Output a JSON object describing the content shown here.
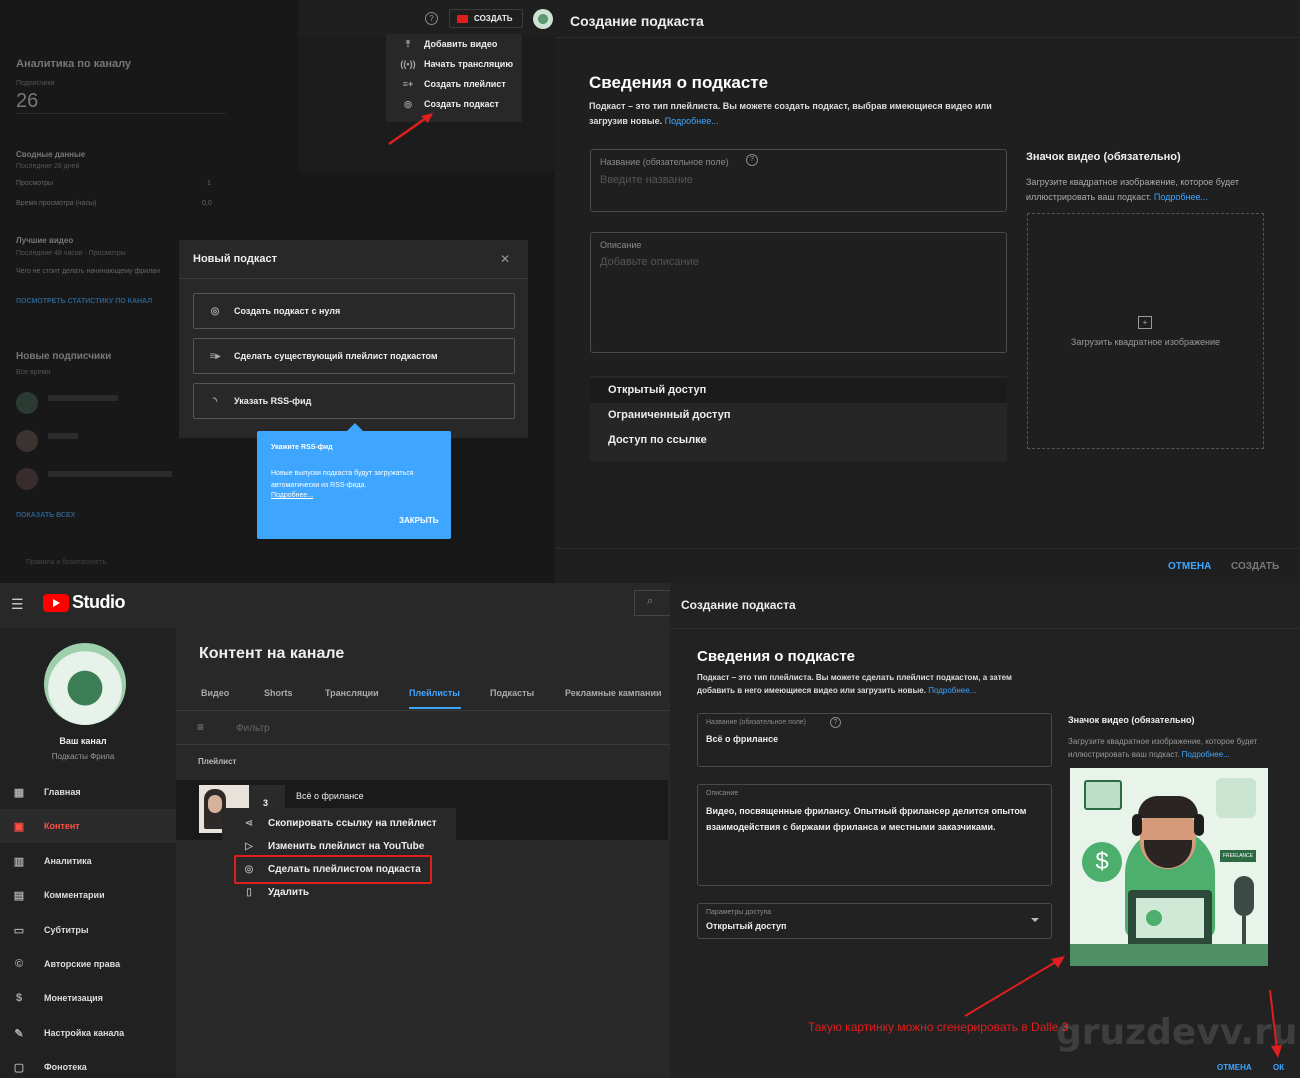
{
  "top_left": {
    "analytics_title": "Аналитика по каналу",
    "subscribers_label": "Подписчики",
    "subscribers_count": "26",
    "summary_title": "Сводные данные",
    "summary_period": "Последние 28 дней",
    "views_label": "Просмотры",
    "views_value": "1",
    "watch_label": "Время просмотра (часы)",
    "watch_value": "0,0",
    "best_video_title": "Лучшие видео",
    "best_video_sub": "Последние 48 часов · Просмотры",
    "best_video_item": "Чего не стоит делать начинающему фрилан",
    "view_stats": "ПОСМОТРЕТЬ СТАТИСТИКУ ПО КАНАЛ",
    "new_subs_title": "Новые подписчики",
    "new_subs_sub": "Все время",
    "show_all": "ПОКАЗАТЬ ВСЕХ",
    "policy": "Правила и безопасность",
    "help_icon": "?",
    "create_label": "СОЗДАТЬ",
    "create_menu": [
      "Добавить видео",
      "Начать трансляцию",
      "Создать плейлист",
      "Создать подкаст"
    ],
    "create_menu_icons": [
      "upload-icon",
      "live-icon",
      "playlist-add-icon",
      "podcast-icon"
    ]
  },
  "modal": {
    "title": "Новый подкаст",
    "close": "✕",
    "options": [
      "Создать подкаст с нуля",
      "Сделать существующий плейлист подкастом",
      "Указать RSS-фид"
    ],
    "tooltip_title": "Укажите RSS-фид",
    "tooltip_text": "Новые выпуски подкаста будут загружаться автоматически из RSS-фида.",
    "tooltip_link": "Подробнее...",
    "tooltip_close": "ЗАКРЫТЬ"
  },
  "top_right": {
    "header_title": "Создание подкаста",
    "section_title": "Сведения о подкасте",
    "section_desc": "Подкаст – это тип плейлиста. Вы можете создать подкаст, выбрав имеющиеся видео или загрузив новые.",
    "more_link": "Подробнее...",
    "name_label": "Название (обязательное поле)",
    "name_placeholder": "Введите название",
    "desc_label": "Описание",
    "desc_placeholder": "Добавьте описание",
    "access_options": [
      "Открытый доступ",
      "Ограниченный доступ",
      "Доступ по ссылке"
    ],
    "thumb_title": "Значок видео (обязательно)",
    "thumb_desc": "Загрузите квадратное изображение, которое будет иллюстрировать ваш подкаст.",
    "thumb_more": "Подробнее...",
    "upload_label": "Загрузить квадратное изображение",
    "cancel": "ОТМЕНА",
    "create": "СОЗДАТЬ"
  },
  "bottom_left": {
    "logo": "Studio",
    "channel_name": "Ваш канал",
    "channel_sub": "Подкасты Фрила",
    "nav": [
      "Главная",
      "Контент",
      "Аналитика",
      "Комментарии",
      "Субтитры",
      "Авторские права",
      "Монетизация",
      "Настройка канала",
      "Фонотека"
    ],
    "nav_icons": [
      "dashboard-icon",
      "content-icon",
      "analytics-icon",
      "comments-icon",
      "subtitles-icon",
      "copyright-icon",
      "monetization-icon",
      "customization-icon",
      "audio-library-icon"
    ],
    "content_title": "Контент на канале",
    "tabs": [
      "Видео",
      "Shorts",
      "Трансляции",
      "Плейлисты",
      "Подкасты",
      "Рекламные кампании"
    ],
    "active_tab": "Плейлисты",
    "filter": "Фильтр",
    "col_playlist": "Плейлист",
    "playlist_name": "Всё о фрилансе",
    "playlist_count": "3",
    "context_menu": [
      "Скопировать ссылку на плейлист",
      "Изменить плейлист на YouTube",
      "Сделать плейлистом подкаста",
      "Удалить"
    ],
    "context_icons": [
      "share-icon",
      "youtube-icon",
      "podcast-icon",
      "trash-icon"
    ]
  },
  "bottom_right": {
    "header_title": "Создание подкаста",
    "section_title": "Сведения о подкасте",
    "section_desc": "Подкаст – это тип плейлиста. Вы можете сделать плейлист подкастом, а затем добавить в него имеющиеся видео или загрузить новые.",
    "more_link": "Подробнее...",
    "name_label": "Название (обязательное поле)",
    "name_value": "Всё о фрилансе",
    "desc_label": "Описание",
    "desc_value": "Видео, посвященные фрилансу. Опытный фрилансер делится опытом взаимодействия с биржами фриланса и местными заказчиками.",
    "access_label": "Параметры доступа",
    "access_value": "Открытый доступ",
    "thumb_title": "Значок видео (обязательно)",
    "thumb_desc": "Загрузите квадратное изображение, которое будет иллюстрировать ваш подкаст.",
    "thumb_more": "Подробнее...",
    "annotation": "Такую картинку можно сгенерировать в Dalle 3",
    "watermark": "gruzdevv.ru",
    "cancel": "ОТМЕНА",
    "ok": "ОК",
    "badge_text": "FREELANCE"
  },
  "colors": {
    "accent": "#3ea6ff",
    "red": "#e01e1e",
    "bg": "#1f1f1f"
  }
}
